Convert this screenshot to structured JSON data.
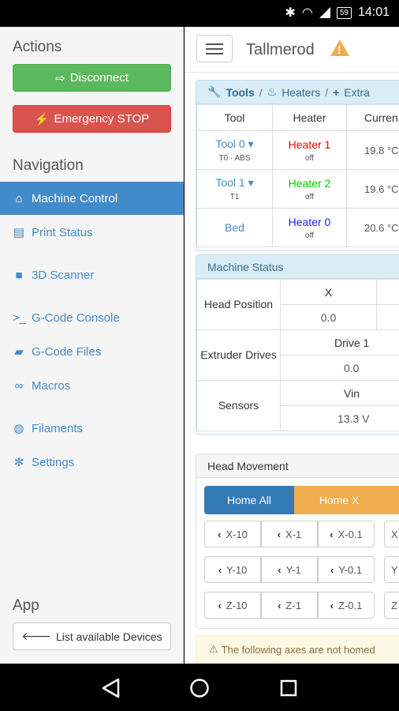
{
  "status_bar": {
    "battery": "59",
    "time": "14:01"
  },
  "sidebar": {
    "actions_heading": "Actions",
    "disconnect_label": "Disconnect",
    "emergency_label": "Emergency STOP",
    "navigation_heading": "Navigation",
    "nav_items": [
      {
        "label": "Machine Control",
        "icon": "home-icon"
      },
      {
        "label": "Print Status",
        "icon": "printer-icon"
      },
      {
        "label": "3D Scanner",
        "icon": "video-camera-icon"
      },
      {
        "label": "G-Code Console",
        "icon": "console-icon"
      },
      {
        "label": "G-Code Files",
        "icon": "storage-icon"
      },
      {
        "label": "Macros",
        "icon": "link-icon"
      },
      {
        "label": "Filaments",
        "icon": "globe-icon"
      },
      {
        "label": "Settings",
        "icon": "gear-icon"
      }
    ],
    "app_heading": "App",
    "list_devices_label": "List available Devices"
  },
  "header": {
    "machine_name": "Tallmerod"
  },
  "tools_panel": {
    "tabs": [
      "Tools",
      "Heaters",
      "Extra"
    ],
    "columns": [
      "Tool",
      "Heater",
      "Curren"
    ],
    "rows": [
      {
        "tool": "Tool 0",
        "tool_sub": "T0 - ABS",
        "heater": "Heater 1",
        "heater_state": "off",
        "current": "19.8 °C"
      },
      {
        "tool": "Tool 1",
        "tool_sub": "T1",
        "heater": "Heater 2",
        "heater_state": "off",
        "current": "19.6 °C"
      },
      {
        "tool": "Bed",
        "tool_sub": "",
        "heater": "Heater 0",
        "heater_state": "off",
        "current": "20.6 °C"
      }
    ]
  },
  "machine_status": {
    "title": "Machine Status",
    "head_position_label": "Head Position",
    "axis_x_label": "X",
    "axis_x_value": "0.0",
    "extruder_drives_label": "Extruder Drives",
    "drive_label": "Drive 1",
    "drive_value": "0.0",
    "sensors_label": "Sensors",
    "vin_label": "Vin",
    "vin_value": "13.3 V"
  },
  "head_movement": {
    "title": "Head Movement",
    "home_all": "Home All",
    "home_x": "Home X",
    "rows": [
      [
        "X-10",
        "X-1",
        "X-0.1",
        "X"
      ],
      [
        "Y-10",
        "Y-1",
        "Y-0.1",
        "Y"
      ],
      [
        "Z-10",
        "Z-1",
        "Z-0.1",
        "Z"
      ]
    ]
  },
  "alert": {
    "text": "The following axes are not homed"
  }
}
